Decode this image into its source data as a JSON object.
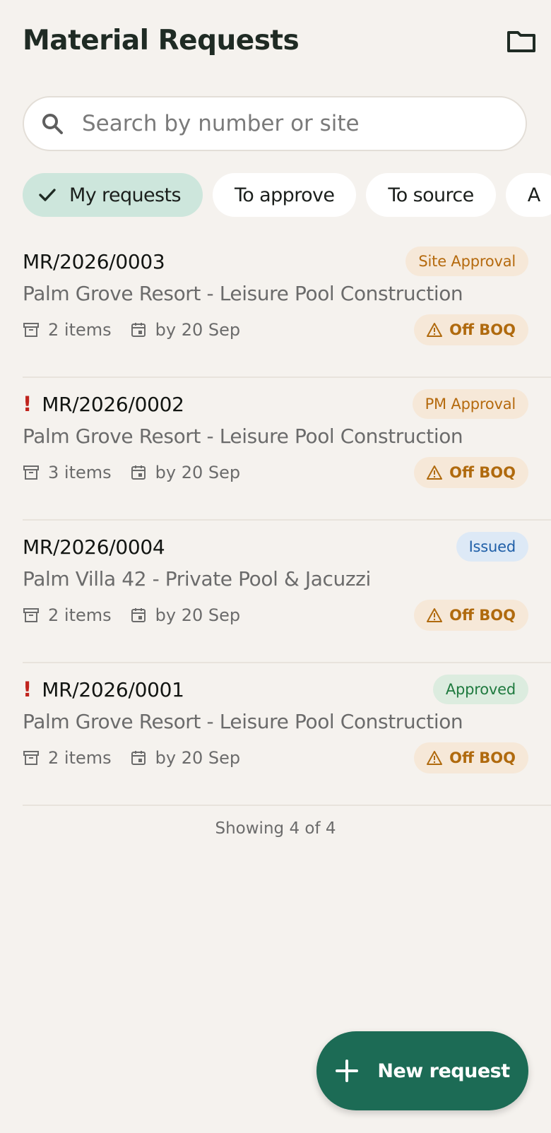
{
  "header": {
    "title": "Material Requests"
  },
  "search": {
    "placeholder": "Search by number or site"
  },
  "filters": [
    {
      "label": "My requests",
      "active": true
    },
    {
      "label": "To approve",
      "active": false
    },
    {
      "label": "To source",
      "active": false
    },
    {
      "label": "A",
      "active": false
    }
  ],
  "requests": [
    {
      "number": "MR/2026/0003",
      "urgent": false,
      "status": "Site Approval",
      "status_color": "#b56a0e",
      "status_bg": "#f6e8d8",
      "site": "Palm Grove Resort - Leisure Pool Construction",
      "items": "2 items",
      "due": "by 20 Sep",
      "flag": "Off BOQ"
    },
    {
      "number": "MR/2026/0002",
      "urgent": true,
      "urgent_mark": "!",
      "status": "PM Approval",
      "status_color": "#b56a0e",
      "status_bg": "#f6e8d8",
      "site": "Palm Grove Resort - Leisure Pool Construction",
      "items": "3 items",
      "due": "by 20 Sep",
      "flag": "Off BOQ"
    },
    {
      "number": "MR/2026/0004",
      "urgent": false,
      "status": "Issued",
      "status_color": "#1f5fa8",
      "status_bg": "#dde9f6",
      "site": "Palm Villa 42 - Private Pool & Jacuzzi",
      "items": "2 items",
      "due": "by 20 Sep",
      "flag": "Off BOQ"
    },
    {
      "number": "MR/2026/0001",
      "urgent": true,
      "urgent_mark": "!",
      "status": "Approved",
      "status_color": "#1f7a3f",
      "status_bg": "#dcecdf",
      "site": "Palm Grove Resort - Leisure Pool Construction",
      "items": "2 items",
      "due": "by 20 Sep",
      "flag": "Off BOQ"
    }
  ],
  "footer": {
    "showing": "Showing 4 of 4"
  },
  "fab": {
    "label": "New request"
  },
  "colors": {
    "accent": "#1c6b55",
    "background": "#f5f2ee"
  },
  "icons": {
    "header": "folder-icon",
    "search": "search-icon",
    "chip": "check-icon",
    "items": "archive-box-icon",
    "due": "calendar-icon",
    "flag": "warning-triangle-icon",
    "fab": "plus-icon"
  }
}
